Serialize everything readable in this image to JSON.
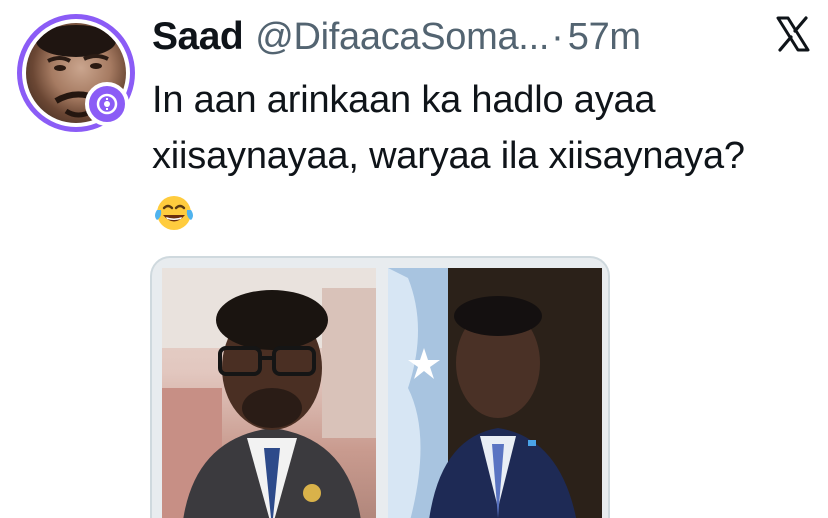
{
  "tweet": {
    "author_name": "Saad",
    "handle": "@DifaacaSoma...",
    "separator": "·",
    "time": "57m",
    "text_lines": [
      "In aan arinkaan ka hadlo ayaa",
      "xiisaynayaa, waryaa ila xiisaynaya?"
    ],
    "emoji": "face-with-tears-of-joy"
  },
  "icons": {
    "platform": "x-logo-icon",
    "avatar_badge": "verified-badge-icon"
  },
  "colors": {
    "avatar_ring": "#8b5cf6",
    "handle_gray": "#536471",
    "text": "#0f1419"
  }
}
